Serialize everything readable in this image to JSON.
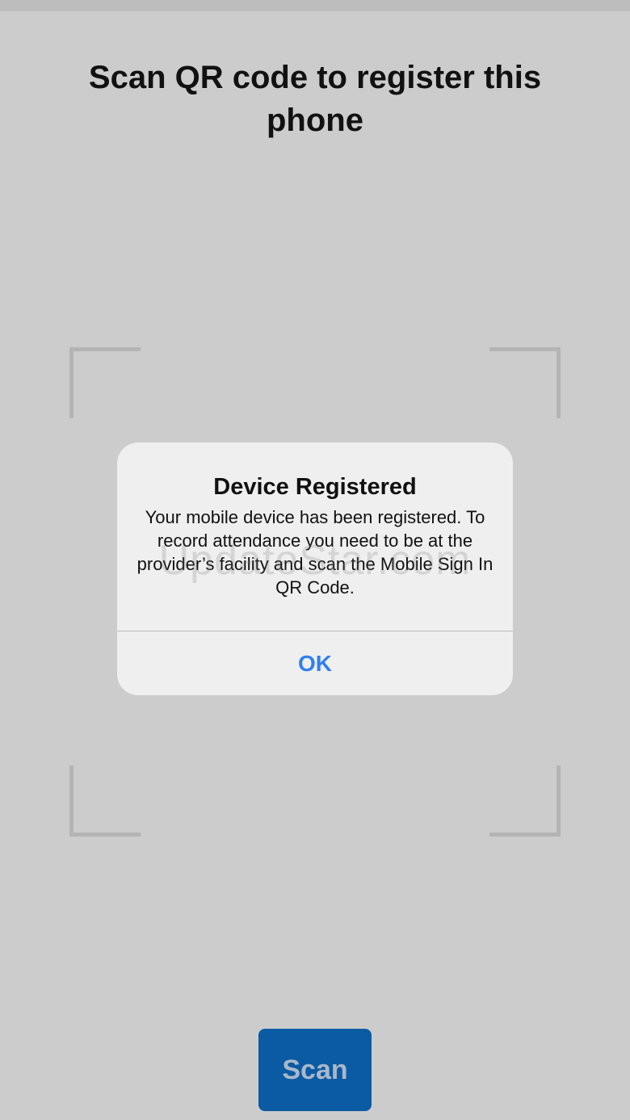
{
  "screen": {
    "title": "Scan QR code to register this phone"
  },
  "alert": {
    "title": "Device Registered",
    "message": "Your mobile device has been registered. To record attendance you need to be at the provider’s facility and scan the Mobile Sign In QR Code.",
    "ok_label": "OK"
  },
  "watermark": {
    "text": "UpdateStar.com"
  },
  "scan_button": {
    "label": "Scan"
  },
  "colors": {
    "background": "#cccccc",
    "alert_background": "#efefef",
    "accent_link": "#2f7ff0",
    "scan_button": "#0b5aa4"
  }
}
